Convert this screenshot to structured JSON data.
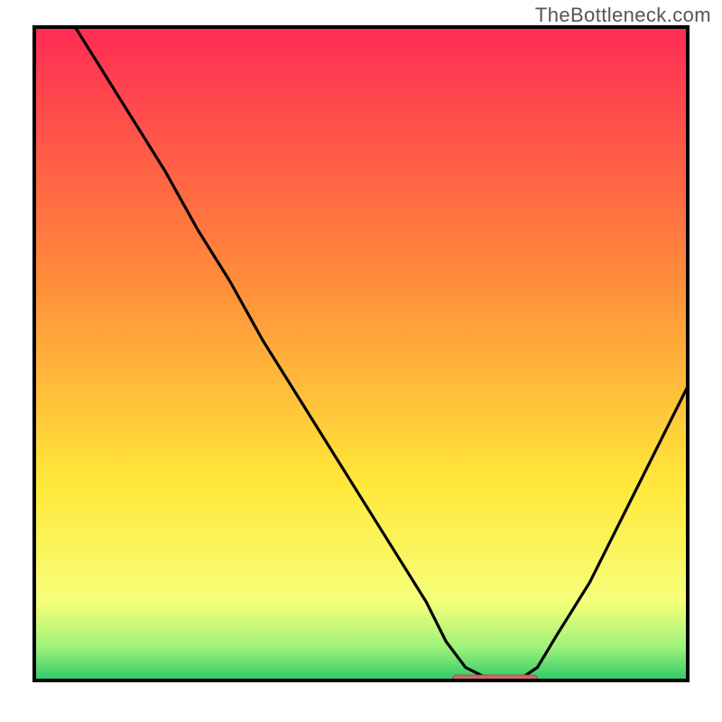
{
  "watermark": "TheBottleneck.com",
  "colors": {
    "frame": "#000000",
    "curve": "#000000",
    "marker_fill": "#cc6b66",
    "marker_stroke": "#a5504c",
    "grad_top": "#ff2b55",
    "grad_mid1": "#ff8a3a",
    "grad_mid2": "#ffe83a",
    "grad_low": "#f6ff7a",
    "grad_green1": "#9df27a",
    "grad_green2": "#2ec96a"
  },
  "chart_data": {
    "type": "line",
    "title": "",
    "xlabel": "",
    "ylabel": "",
    "xlim": [
      0,
      100
    ],
    "ylim": [
      0,
      100
    ],
    "x": [
      0,
      5,
      10,
      15,
      20,
      25,
      30,
      35,
      40,
      45,
      50,
      55,
      60,
      63,
      66,
      70,
      74,
      77,
      80,
      85,
      90,
      95,
      100
    ],
    "values": [
      110,
      102,
      94,
      86,
      78,
      69,
      61,
      52,
      44,
      36,
      28,
      20,
      12,
      6,
      2,
      0,
      0,
      2,
      7,
      15,
      25,
      35,
      45
    ],
    "minimum_band": {
      "x_start": 64,
      "x_end": 77,
      "y": 0
    }
  }
}
